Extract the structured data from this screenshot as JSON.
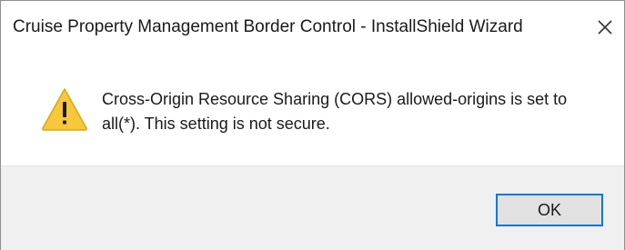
{
  "window": {
    "title": "Cruise Property Management Border Control - InstallShield Wizard",
    "close_icon": "close-icon"
  },
  "message": {
    "icon": "warning-icon",
    "text": "Cross-Origin Resource Sharing (CORS) allowed-origins is set to all(*). This setting is not secure."
  },
  "buttons": {
    "ok_label": "OK"
  },
  "colors": {
    "warning_fill": "#f7c83b",
    "warning_outline": "#d9a70d",
    "accent_border": "#0078d7",
    "footer_background": "#f0f0f0",
    "button_background": "#e1e1e1"
  }
}
